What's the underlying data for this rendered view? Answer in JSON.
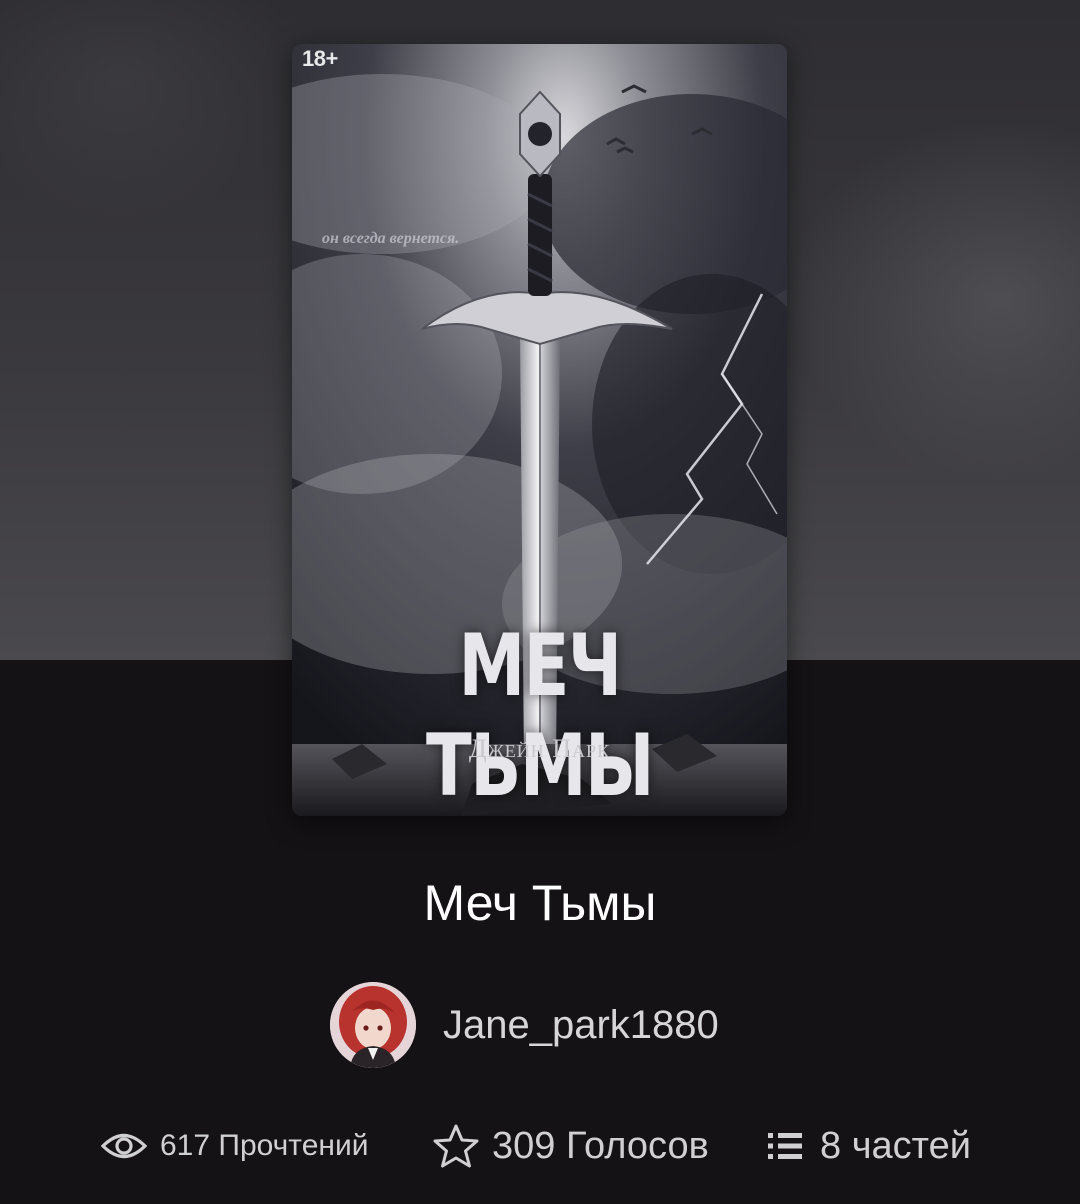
{
  "cover": {
    "age_badge": "18+",
    "tagline": "он всегда вернется.",
    "title": "МЕЧ ТЬМЫ",
    "author": "Джейн Парк"
  },
  "book": {
    "title": "Меч Тьмы"
  },
  "author": {
    "username": "Jane_park1880"
  },
  "stats": {
    "reads_label": "617 Прочтений",
    "votes_label": "309 Голосов",
    "parts_label": "8 частей"
  },
  "icons": {
    "reads": "eye-icon",
    "votes": "star-icon",
    "parts": "list-icon"
  },
  "colors": {
    "background": "#141214",
    "text_primary": "#ffffff",
    "text_secondary": "#d0d0d3"
  }
}
